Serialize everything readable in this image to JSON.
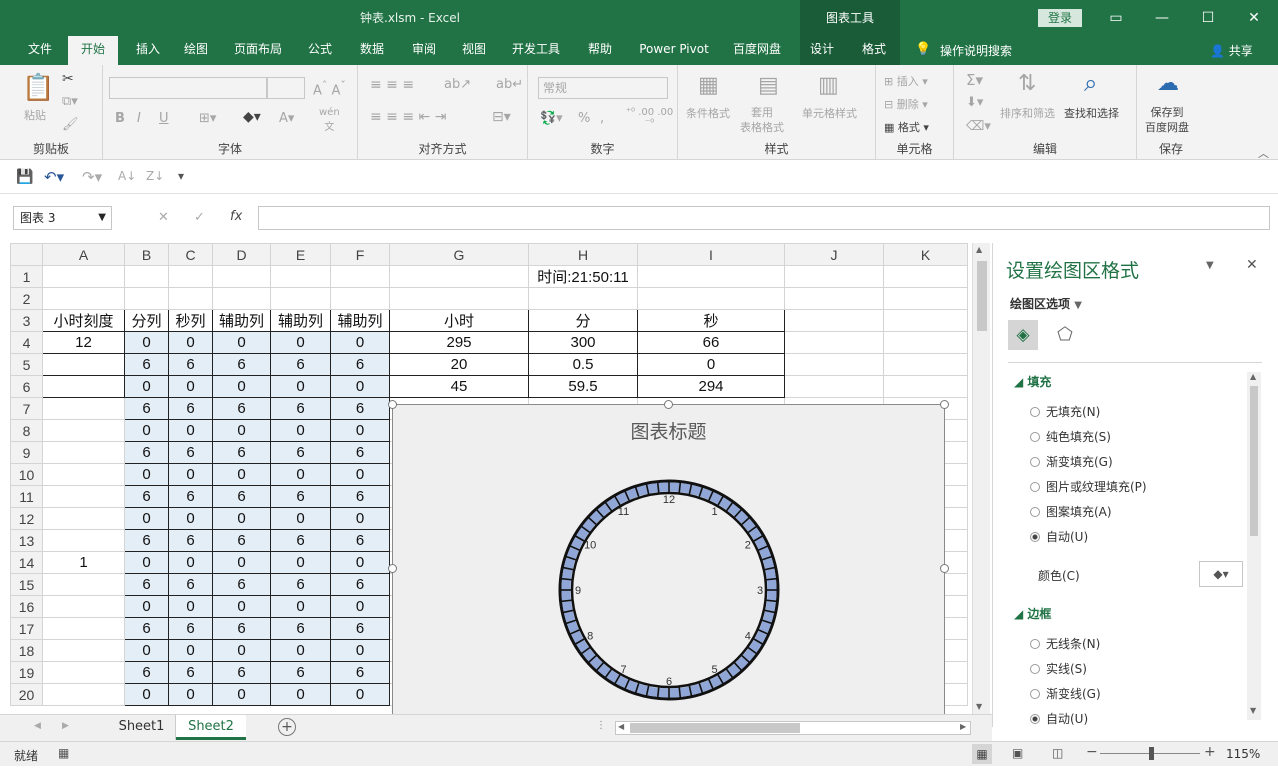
{
  "window": {
    "title": "钟表.xlsm  -  Excel",
    "context_tools": "图表工具",
    "login": "登录",
    "colors": {
      "brand": "#217346",
      "context": "#1a5c38",
      "selection": "#e4eef7",
      "clock_ring": "#8fa6d6"
    }
  },
  "tabs": [
    "文件",
    "开始",
    "插入",
    "绘图",
    "页面布局",
    "公式",
    "数据",
    "审阅",
    "视图",
    "开发工具",
    "帮助",
    "Power Pivot",
    "百度网盘",
    "设计",
    "格式"
  ],
  "tell_me": "操作说明搜索",
  "share": "共享",
  "ribbon": {
    "groups": {
      "clipboard": "剪贴板",
      "font": "字体",
      "align": "对齐方式",
      "number": "数字",
      "styles": "样式",
      "cells": "单元格",
      "editing": "编辑",
      "save": "保存"
    },
    "paste": "粘贴",
    "number_format": "常规",
    "cond_format": "条件格式",
    "table_format": "套用\n表格格式",
    "cell_styles": "单元格样式",
    "insert": "插入",
    "delete": "删除",
    "format": "格式",
    "sort_filter": "排序和筛选",
    "find_select": "查找和选择",
    "save_baidu": "保存到\n百度网盘",
    "bold": "B",
    "italic": "I",
    "underline": "U",
    "percent": "%"
  },
  "namebox": "图表 3",
  "fx": "fx",
  "columns": [
    "A",
    "B",
    "C",
    "D",
    "E",
    "F",
    "G",
    "H",
    "I",
    "J",
    "K"
  ],
  "rows": [
    [
      "",
      "",
      "",
      "",
      "",
      "",
      "",
      "时间:21:50:11",
      "",
      "",
      ""
    ],
    [
      "",
      "",
      "",
      "",
      "",
      "",
      "",
      "",
      "",
      "",
      ""
    ],
    [
      "小时刻度",
      "分列",
      "秒列",
      "辅助列",
      "辅助列",
      "辅助列",
      "小时",
      "分",
      "秒",
      "",
      ""
    ],
    [
      "12",
      "0",
      "0",
      "0",
      "0",
      "0",
      "295",
      "300",
      "66",
      "",
      ""
    ],
    [
      "",
      "6",
      "6",
      "6",
      "6",
      "6",
      "20",
      "0.5",
      "0",
      "",
      ""
    ],
    [
      "",
      "0",
      "0",
      "0",
      "0",
      "0",
      "45",
      "59.5",
      "294",
      "",
      ""
    ],
    [
      "",
      "6",
      "6",
      "6",
      "6",
      "6",
      "",
      "",
      "",
      "",
      ""
    ],
    [
      "",
      "0",
      "0",
      "0",
      "0",
      "0",
      "",
      "",
      "",
      "",
      ""
    ],
    [
      "",
      "6",
      "6",
      "6",
      "6",
      "6",
      "",
      "",
      "",
      "",
      ""
    ],
    [
      "",
      "0",
      "0",
      "0",
      "0",
      "0",
      "",
      "",
      "",
      "",
      ""
    ],
    [
      "",
      "6",
      "6",
      "6",
      "6",
      "6",
      "",
      "",
      "",
      "",
      ""
    ],
    [
      "",
      "0",
      "0",
      "0",
      "0",
      "0",
      "",
      "",
      "",
      "",
      ""
    ],
    [
      "",
      "6",
      "6",
      "6",
      "6",
      "6",
      "",
      "",
      "",
      "",
      ""
    ],
    [
      "1",
      "0",
      "0",
      "0",
      "0",
      "0",
      "",
      "",
      "",
      "",
      ""
    ],
    [
      "",
      "6",
      "6",
      "6",
      "6",
      "6",
      "",
      "",
      "",
      "",
      ""
    ],
    [
      "",
      "0",
      "0",
      "0",
      "0",
      "0",
      "",
      "",
      "",
      "",
      ""
    ],
    [
      "",
      "6",
      "6",
      "6",
      "6",
      "6",
      "",
      "",
      "",
      "",
      ""
    ],
    [
      "",
      "0",
      "0",
      "0",
      "0",
      "0",
      "",
      "",
      "",
      "",
      ""
    ],
    [
      "",
      "6",
      "6",
      "6",
      "6",
      "6",
      "",
      "",
      "",
      "",
      ""
    ],
    [
      "",
      "0",
      "0",
      "0",
      "0",
      "0",
      "",
      "",
      "",
      "",
      ""
    ]
  ],
  "chart": {
    "title": "图表标题",
    "hour_labels": [
      "12",
      "1",
      "2",
      "3",
      "4",
      "5",
      "6",
      "7",
      "8",
      "9",
      "10",
      "11"
    ]
  },
  "pane": {
    "title": "设置绘图区格式",
    "options": "绘图区选项",
    "fill_section": "填充",
    "fill_options": [
      "无填充(N)",
      "纯色填充(S)",
      "渐变填充(G)",
      "图片或纹理填充(P)",
      "图案填充(A)",
      "自动(U)"
    ],
    "fill_selected": 5,
    "color_label": "颜色(C)",
    "border_section": "边框",
    "border_options": [
      "无线条(N)",
      "实线(S)",
      "渐变线(G)",
      "自动(U)"
    ],
    "border_selected": 3
  },
  "sheet_tabs": [
    "Sheet1",
    "Sheet2"
  ],
  "active_sheet": 1,
  "status": {
    "ready": "就绪",
    "zoom": "115%"
  }
}
